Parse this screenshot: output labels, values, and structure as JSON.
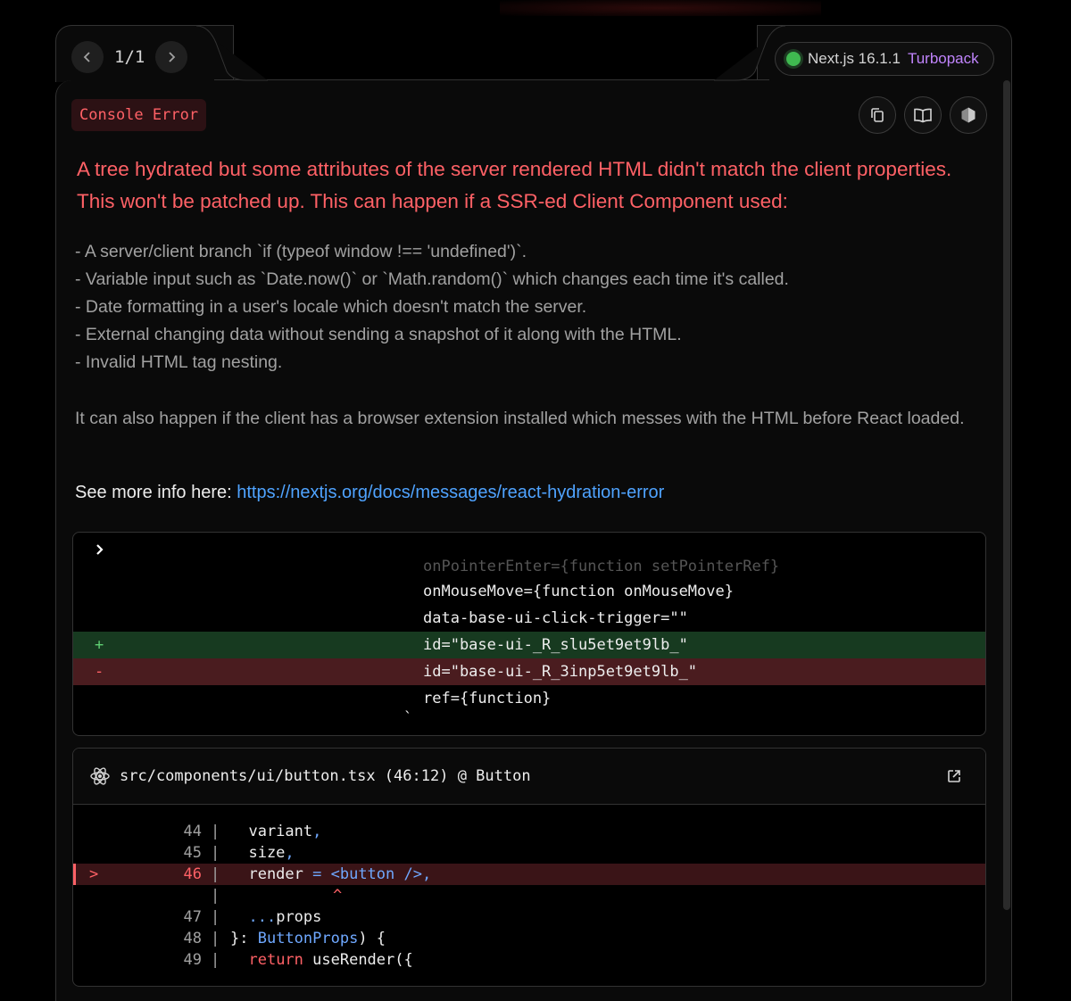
{
  "pagination": {
    "current": "1/1"
  },
  "version": {
    "nextjs": "Next.js 16.1.1",
    "bundler": "Turbopack"
  },
  "badge": "Console Error",
  "title": "A tree hydrated but some attributes of the server rendered HTML didn't match the client properties. This won't be patched up. This can happen if a SSR-ed Client Component used:",
  "causes": [
    "- A server/client branch `if (typeof window !== 'undefined')`.",
    "- Variable input such as `Date.now()` or `Math.random()` which changes each time it's called.",
    "- Date formatting in a user's locale which doesn't match the server.",
    "- External changing data without sending a snapshot of it along with the HTML.",
    "- Invalid HTML tag nesting."
  ],
  "extension_note": "It can also happen if the client has a browser extension installed which messes with the HTML before React loaded.",
  "see_more": {
    "label": "See more info here:",
    "url": "https://nextjs.org/docs/messages/react-hydration-error"
  },
  "diff": {
    "faded": "onPointerEnter={function setPointerRef}",
    "lines": [
      {
        "sign": "",
        "code": "onMouseMove={function onMouseMove}"
      },
      {
        "sign": "",
        "code": "data-base-ui-click-trigger=\"\""
      },
      {
        "sign": "+",
        "code": "id=\"base-ui-_R_slu5et9et9lb_\""
      },
      {
        "sign": "-",
        "code": "id=\"base-ui-_R_3inp5et9et9lb_\""
      },
      {
        "sign": "",
        "code": "ref={function}"
      }
    ],
    "tail": "`"
  },
  "source": {
    "path": "src/components/ui/button.tsx (46:12) @ Button",
    "lines": [
      {
        "n": "44",
        "a": "  variant",
        "b": ",",
        "c": "",
        "d": ""
      },
      {
        "n": "45",
        "a": "  size",
        "b": ",",
        "c": "",
        "d": ""
      },
      {
        "n": "46",
        "a": "  render ",
        "b": "= ",
        "c": "<button />",
        "d": ","
      },
      {
        "n": "",
        "a": "",
        "b": "",
        "c": "",
        "d": ""
      },
      {
        "n": "47",
        "a": "  ...props",
        "b": "",
        "c": "",
        "d": ""
      },
      {
        "n": "48",
        "a": "}: ",
        "b": "",
        "c": "ButtonProps",
        "d": ") {"
      },
      {
        "n": "49",
        "a": "  ",
        "b": "return",
        "c": "",
        "d": " useRender({"
      }
    ],
    "caret": "^",
    "marker": ">"
  }
}
